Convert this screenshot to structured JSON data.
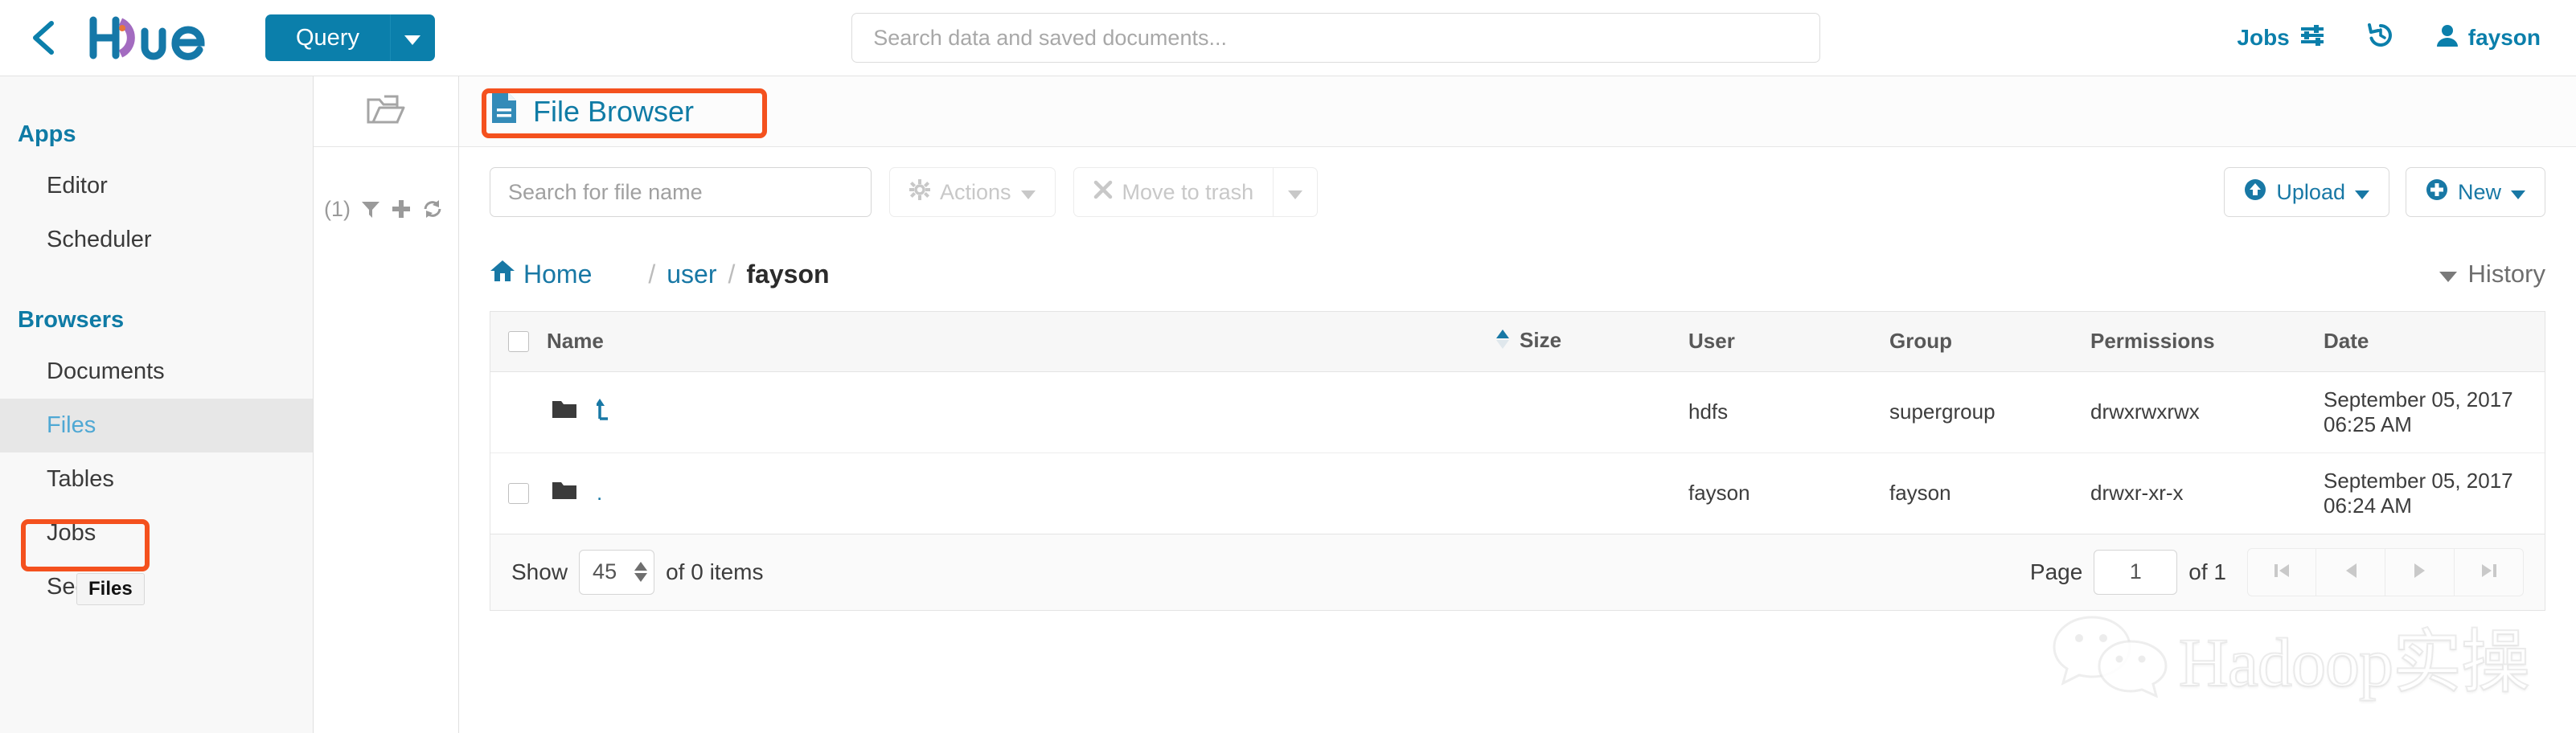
{
  "header": {
    "back_icon": "chevron-left-icon",
    "logo_text": "Hue",
    "query_button": "Query",
    "query_caret_icon": "caret-down-icon",
    "search_placeholder": "Search data and saved documents...",
    "search_value": "",
    "jobs_label": "Jobs",
    "jobs_icon": "sliders-icon",
    "history_icon": "history-icon",
    "user_icon": "user-icon",
    "user_name": "fayson"
  },
  "sidebar": {
    "groups": [
      {
        "title": "Apps",
        "items": [
          {
            "label": "Editor",
            "active": false
          },
          {
            "label": "Scheduler",
            "active": false
          }
        ]
      },
      {
        "title": "Browsers",
        "items": [
          {
            "label": "Documents",
            "active": false
          },
          {
            "label": "Files",
            "active": true
          },
          {
            "label": "Tables",
            "active": false
          },
          {
            "label": "Jobs",
            "active": false
          },
          {
            "label": "Security",
            "active": false
          }
        ]
      }
    ],
    "tooltip": "Files"
  },
  "assist": {
    "folder_icon": "folder-open-icon",
    "count_label": "(1)",
    "filter_icon": "filter-icon",
    "add_icon": "plus-icon",
    "refresh_icon": "refresh-icon"
  },
  "main": {
    "title": "File Browser",
    "title_icon": "file-document-icon",
    "toolbar": {
      "search_placeholder": "Search for file name",
      "search_value": "",
      "actions_label": "Actions",
      "actions_icon": "gear-icon",
      "trash_label": "Move to trash",
      "trash_icon": "times-icon",
      "trash_caret_icon": "caret-down-icon",
      "upload_label": "Upload",
      "upload_icon": "arrow-circle-up-icon",
      "new_label": "New",
      "new_icon": "plus-circle-icon",
      "caret_icon": "caret-down-icon"
    },
    "breadcrumb": {
      "home_label": "Home",
      "home_icon": "home-icon",
      "separator": "/",
      "parts": [
        {
          "label": "user",
          "current": false
        },
        {
          "label": "fayson",
          "current": true
        }
      ]
    },
    "history_label": "History",
    "history_icon": "caret-down-icon"
  },
  "table": {
    "columns": [
      {
        "key": "check",
        "label": ""
      },
      {
        "key": "name",
        "label": "Name"
      },
      {
        "key": "size",
        "label": "Size",
        "sorted": true,
        "sort_icon": "sort-asc-icon"
      },
      {
        "key": "user",
        "label": "User"
      },
      {
        "key": "group",
        "label": "Group"
      },
      {
        "key": "permissions",
        "label": "Permissions"
      },
      {
        "key": "date",
        "label": "Date"
      }
    ],
    "rows": [
      {
        "checkbox": false,
        "show_checkbox": false,
        "icon": "folder-icon",
        "name_icon": "arrow-up-parent-icon",
        "name": "",
        "size": "",
        "user": "hdfs",
        "group": "supergroup",
        "permissions": "drwxrwxrwx",
        "date": "September 05, 2017 06:25 AM"
      },
      {
        "checkbox": false,
        "show_checkbox": true,
        "icon": "folder-icon",
        "name_icon": "",
        "name": ".",
        "size": "",
        "user": "fayson",
        "group": "fayson",
        "permissions": "drwxr-xr-x",
        "date": "September 05, 2017 06:24 AM"
      }
    ]
  },
  "footer": {
    "show_label": "Show",
    "page_size": "45",
    "items_label": "of 0 items",
    "page_label": "Page",
    "page_number": "1",
    "page_of": "of 1",
    "first_icon": "step-backward-icon",
    "prev_icon": "caret-left-icon",
    "next_icon": "caret-right-icon",
    "last_icon": "step-forward-icon"
  },
  "watermark": {
    "text": "Hadoop实操",
    "logo_icon": "wechat-icon"
  },
  "colors": {
    "accent_blue": "#0B7FAB",
    "link_blue": "#1878A5",
    "active_blue": "#4FA8D4",
    "annotation_orange": "#F4511E",
    "icon_blue": "#338BB8"
  }
}
